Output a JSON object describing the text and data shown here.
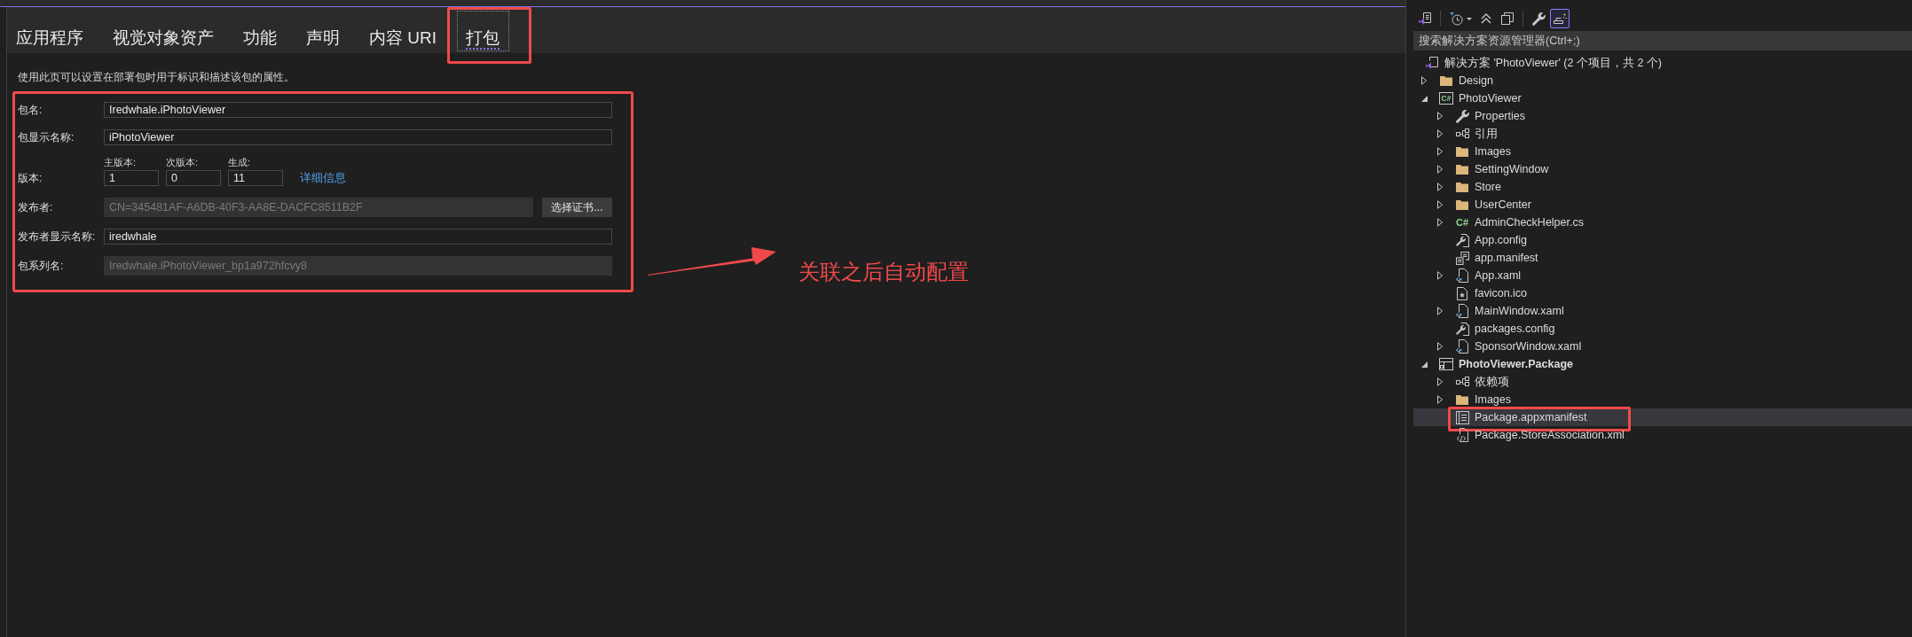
{
  "editor": {
    "tabs": [
      {
        "label": "应用程序",
        "selected": false,
        "marked": false
      },
      {
        "label": "视觉对象资产",
        "selected": false,
        "marked": false
      },
      {
        "label": "功能",
        "selected": false,
        "marked": false
      },
      {
        "label": "声明",
        "selected": false,
        "marked": false
      },
      {
        "label": "内容 URI",
        "selected": false,
        "marked": false
      },
      {
        "label": "打包",
        "selected": true,
        "marked": true
      }
    ],
    "description": "使用此页可以设置在部署包时用于标识和描述该包的属性。",
    "form": {
      "marked": true,
      "fields": [
        {
          "kind": "text",
          "label": "包名:",
          "value": "Iredwhale.iPhotoViewer",
          "disabled": false
        },
        {
          "kind": "text",
          "label": "包显示名称:",
          "value": "iPhotoViewer",
          "disabled": false
        },
        {
          "kind": "version",
          "label": "版本:",
          "parts": [
            {
              "label": "主版本:",
              "value": "1"
            },
            {
              "label": "次版本:",
              "value": "0"
            },
            {
              "label": "生成:",
              "value": "11"
            }
          ],
          "link": "详细信息"
        },
        {
          "kind": "text",
          "label": "发布者:",
          "value": "CN=345481AF-A6DB-40F3-AA8E-DACFC8511B2F",
          "disabled": true,
          "button": "选择证书..."
        },
        {
          "kind": "text",
          "label": "发布者显示名称:",
          "value": "iredwhale",
          "disabled": false
        },
        {
          "kind": "text",
          "label": "包系列名:",
          "value": "Iredwhale.iPhotoViewer_bp1a972hfcvy8",
          "disabled": true
        }
      ]
    }
  },
  "annotation": {
    "text": "关联之后自动配置"
  },
  "solution_explorer": {
    "toolbar": [
      {
        "buttons": [
          {
            "kind": "home",
            "on": false
          }
        ]
      },
      {
        "buttons": [
          {
            "kind": "history",
            "on": false
          },
          {
            "kind": "collapse",
            "on": false
          },
          {
            "kind": "pages",
            "on": false
          }
        ]
      },
      {
        "buttons": [
          {
            "kind": "wrench",
            "on": false
          },
          {
            "kind": "preview",
            "on": true
          }
        ]
      }
    ],
    "search": {
      "placeholder": "搜索解决方案资源管理器(Ctrl+;)"
    },
    "tree": [
      {
        "label": "解决方案 'PhotoViewer' (2 个项目，共 2 个)",
        "kind": "solution",
        "selected": false,
        "marked": false,
        "children": [
          {
            "label": "Design",
            "kind": "folder",
            "expanded": false,
            "selected": false,
            "marked": false,
            "startup": false
          },
          {
            "label": "PhotoViewer",
            "kind": "project",
            "icon_text": "C#",
            "expanded": true,
            "selected": false,
            "marked": false,
            "startup": false,
            "children": [
              {
                "label": "Properties",
                "kind": "properties",
                "expanded": false,
                "selected": false,
                "marked": false
              },
              {
                "label": "引用",
                "kind": "references",
                "expanded": false,
                "selected": false,
                "marked": false
              },
              {
                "label": "Images",
                "kind": "folder",
                "expanded": false,
                "selected": false,
                "marked": false
              },
              {
                "label": "SettingWindow",
                "kind": "folder",
                "expanded": false,
                "selected": false,
                "marked": false
              },
              {
                "label": "Store",
                "kind": "folder",
                "expanded": false,
                "selected": false,
                "marked": false
              },
              {
                "label": "UserCenter",
                "kind": "folder",
                "expanded": false,
                "selected": false,
                "marked": false
              },
              {
                "label": "AdminCheckHelper.cs",
                "kind": "csfile",
                "icon_text": "C#",
                "expanded": false,
                "selected": false,
                "marked": false
              },
              {
                "label": "App.config",
                "kind": "config",
                "selected": false,
                "marked": false
              },
              {
                "label": "app.manifest",
                "kind": "manifest",
                "selected": false,
                "marked": false
              },
              {
                "label": "App.xaml",
                "kind": "xaml",
                "expanded": false,
                "selected": false,
                "marked": false
              },
              {
                "label": "favicon.ico",
                "kind": "image",
                "selected": false,
                "marked": false
              },
              {
                "label": "MainWindow.xaml",
                "kind": "xaml",
                "expanded": false,
                "selected": false,
                "marked": false
              },
              {
                "label": "packages.config",
                "kind": "config",
                "selected": false,
                "marked": false
              },
              {
                "label": "SponsorWindow.xaml",
                "kind": "xaml",
                "expanded": false,
                "selected": false,
                "marked": false
              }
            ]
          },
          {
            "label": "PhotoViewer.Package",
            "kind": "package",
            "expanded": true,
            "selected": false,
            "marked": false,
            "startup": true,
            "children": [
              {
                "label": "依赖项",
                "kind": "references",
                "expanded": false,
                "selected": false,
                "marked": false
              },
              {
                "label": "Images",
                "kind": "folder",
                "expanded": false,
                "selected": false,
                "marked": false
              },
              {
                "label": "Package.appxmanifest",
                "kind": "appxmanifest",
                "selected": true,
                "marked": true
              },
              {
                "label": "Package.StoreAssociation.xml",
                "kind": "xml",
                "selected": false,
                "marked": false
              }
            ]
          }
        ]
      }
    ]
  }
}
